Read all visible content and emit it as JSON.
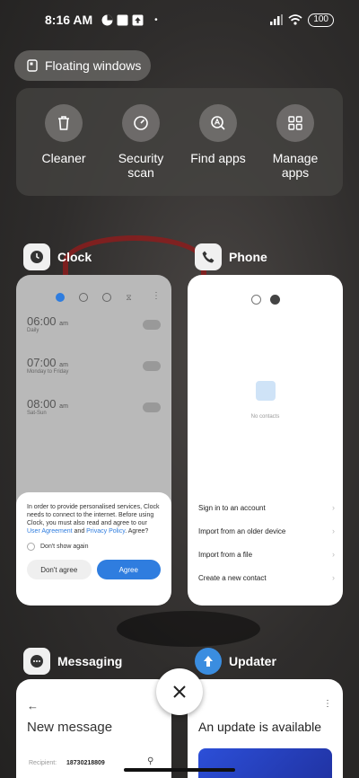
{
  "status_bar": {
    "time": "8:16 AM",
    "battery": "100"
  },
  "floating_windows": {
    "label": "Floating windows"
  },
  "quick_actions": [
    {
      "label": "Cleaner",
      "icon": "trash-icon"
    },
    {
      "label": "Security scan",
      "icon": "gauge-icon"
    },
    {
      "label": "Find apps",
      "icon": "search-app-icon"
    },
    {
      "label": "Manage apps",
      "icon": "grid-icon"
    }
  ],
  "apps": {
    "clock": {
      "name": "Clock",
      "alarms": [
        {
          "time": "06:00",
          "ampm": "am",
          "sub": "Daily"
        },
        {
          "time": "07:00",
          "ampm": "am",
          "sub": "Monday to Friday"
        },
        {
          "time": "08:00",
          "ampm": "am",
          "sub": "Sat-Sun"
        }
      ],
      "dialog": {
        "text_before": "In order to provide personalised services, Clock needs to connect to the internet. Before using Clock, you must also read and agree to our ",
        "link_agreement": "User Agreement",
        "and": " and ",
        "link_privacy": "Privacy Policy",
        "text_after": ". Agree?",
        "checkbox_label": "Don't show again",
        "decline_label": "Don't agree",
        "agree_label": "Agree"
      }
    },
    "phone": {
      "name": "Phone",
      "empty_text": "No contacts",
      "items": [
        "Sign in to an account",
        "Import from an older device",
        "Import from a file",
        "Create a new contact"
      ]
    },
    "messaging": {
      "name": "Messaging",
      "title": "New message",
      "recipient_label": "Recipient:",
      "recipient_number": "18730218809"
    },
    "updater": {
      "name": "Updater",
      "title": "An update is available"
    }
  }
}
